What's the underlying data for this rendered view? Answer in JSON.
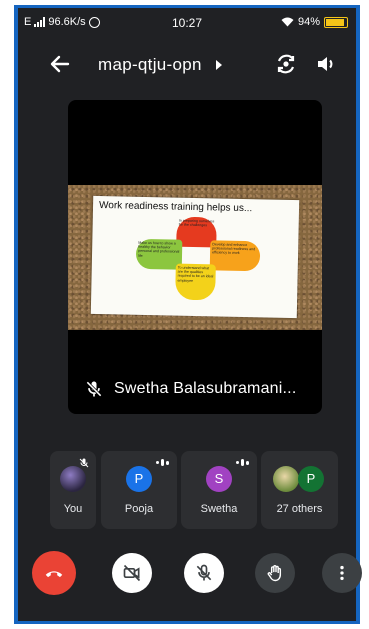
{
  "status_bar": {
    "network": "E",
    "speed": "96.6K/s",
    "time": "10:27",
    "battery": "94%"
  },
  "header": {
    "meeting_code": "map-qtju-opn",
    "back_icon": "arrow-back-icon",
    "camera_switch_icon": "camera-switch-icon",
    "speaker_icon": "volume-icon"
  },
  "main_tile": {
    "participant_name": "Swetha Balasubramani...",
    "slide": {
      "title": "Work readiness training helps us...",
      "petals": {
        "red": "In preparing ourselves for the challenges",
        "green": "Make us how to show a healthy the behavior personal and professional life",
        "orange": "Develop and enhance professional readiness and efficiency to work",
        "yellow": "To understand what are the qualities required to be an ideal employee"
      }
    }
  },
  "participants": [
    {
      "name": "You",
      "initial": ""
    },
    {
      "name": "Pooja",
      "initial": "P"
    },
    {
      "name": "Swetha",
      "initial": "S"
    },
    {
      "name": "27 others",
      "initial": "P"
    }
  ],
  "colors": {
    "frame": "#1565c0",
    "background": "#202124",
    "tile_bg": "#2d2e31",
    "end_call": "#ea4335",
    "pooja_avatar": "#1a73e8",
    "swetha_avatar": "#a142c2",
    "others_avatar": "#137333"
  }
}
